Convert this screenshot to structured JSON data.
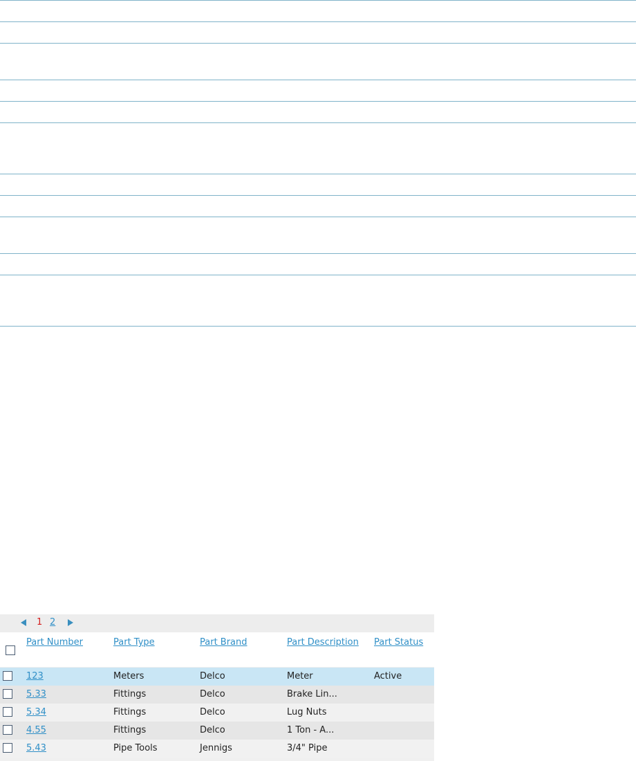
{
  "pager": {
    "pages": [
      "1",
      "2"
    ],
    "current": "1",
    "prev_icon": "arrow-left-icon",
    "next_icon": "arrow-right-icon"
  },
  "columns": [
    "Part Number",
    "Part Type",
    "Part Brand",
    "Part Description",
    "Part Status"
  ],
  "rows": [
    {
      "part_number": "123 ",
      "part_type": "Meters",
      "part_brand": "Delco",
      "part_description": "Meter",
      "part_status": "Active",
      "selected": true
    },
    {
      "part_number": "5.33 ",
      "part_type": "Fittings",
      "part_brand": "Delco",
      "part_description": "Brake Lin...",
      "part_status": "",
      "selected": false
    },
    {
      "part_number": "5.34 ",
      "part_type": "Fittings",
      "part_brand": "Delco",
      "part_description": "Lug Nuts",
      "part_status": "",
      "selected": false
    },
    {
      "part_number": "4.55 ",
      "part_type": "Fittings",
      "part_brand": "Delco",
      "part_description": "1 Ton - A...",
      "part_status": "",
      "selected": false
    },
    {
      "part_number": "5.43 ",
      "part_type": "Pipe Tools",
      "part_brand": "Jennigs",
      "part_description": "3/4\" Pipe",
      "part_status": "",
      "selected": false
    }
  ],
  "colors": {
    "rule": "#7fb3c9",
    "link": "#2f8fc7",
    "current_page": "#d41d1d",
    "selected_row": "#c9e6f5",
    "row_even": "#f1f1f1",
    "row_odd": "#e6e6e6"
  }
}
